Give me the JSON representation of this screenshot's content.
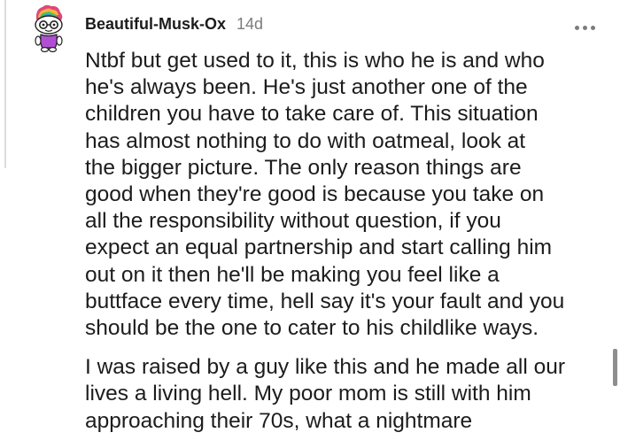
{
  "comment": {
    "author": "Beautiful-Musk-Ox",
    "age": "14d",
    "menu_icon": "more-horizontal-icon",
    "avatar_icon": "snoo-avatar-icon",
    "paragraphs": [
      {
        "lines": [
          "Ntbf but get used to it, this is who he is and who",
          "he's always been. He's just another one of the",
          "children you have to take care of. This situation",
          "has almost nothing to do with oatmeal, look at",
          "the bigger picture. The only reason things are",
          "good when they're good is because you take on",
          "all the responsibility without question, if you",
          "expect an equal partnership and start calling him",
          "out on it then he'll be making you feel like a",
          "buttface every time, hell say it's your fault and you",
          "should be the one to cater to his childlike ways."
        ]
      },
      {
        "lines": [
          "I was raised by a guy like this and he made all our",
          "lives a living hell. My poor mom is still with him",
          "approaching their 70s, what a nightmare"
        ]
      }
    ]
  }
}
